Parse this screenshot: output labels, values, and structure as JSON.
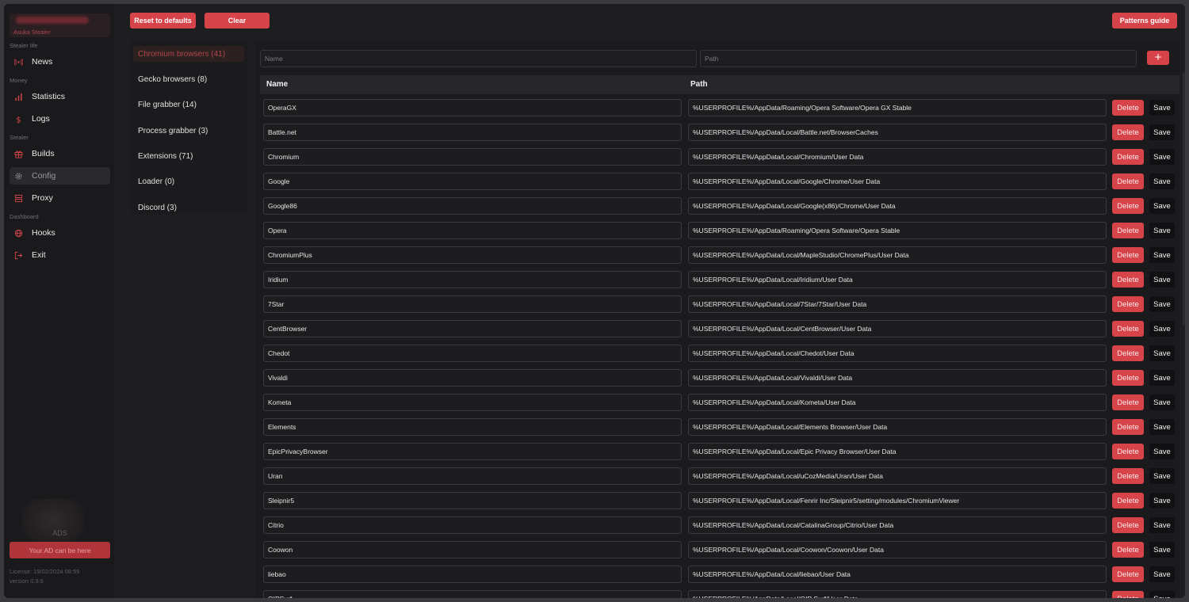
{
  "sidebar": {
    "brand_sub": "Asuka Stealer",
    "sections": {
      "stealer_life": "Stealer life",
      "money": "Money",
      "stealer": "Stealer",
      "dashboard": "Dashboard"
    },
    "items": [
      {
        "label": "News",
        "icon": "broadcast-icon"
      },
      {
        "label": "Statistics",
        "icon": "bar-chart-icon"
      },
      {
        "label": "Logs",
        "icon": "dollar-icon"
      },
      {
        "label": "Builds",
        "icon": "gift-icon"
      },
      {
        "label": "Config",
        "icon": "gear-icon",
        "active": true
      },
      {
        "label": "Proxy",
        "icon": "server-icon"
      },
      {
        "label": "Hooks",
        "icon": "globe-icon"
      },
      {
        "label": "Exit",
        "icon": "logout-icon"
      }
    ],
    "ads_label": "ADS",
    "ad_button": "Your AD can be here",
    "license": "License: 19/02/2024 08:59",
    "version": "version 0.9.6"
  },
  "toolbar": {
    "reset_label": "Reset to defaults",
    "clear_label": "Clear",
    "guide_label": "Patterns guide"
  },
  "categories": [
    {
      "label": "Chromium browsers (41)",
      "active": true
    },
    {
      "label": "Gecko browsers (8)"
    },
    {
      "label": "File grabber (14)"
    },
    {
      "label": "Process grabber (3)"
    },
    {
      "label": "Extensions (71)"
    },
    {
      "label": "Loader (0)"
    },
    {
      "label": "Discord (3)"
    }
  ],
  "form": {
    "name_placeholder": "Name",
    "path_placeholder": "Path",
    "add_symbol": "+"
  },
  "table": {
    "headers": {
      "name": "Name",
      "path": "Path"
    },
    "delete_label": "Delete",
    "save_label": "Save",
    "rows": [
      {
        "name": "OperaGX",
        "path": "%USERPROFILE%/AppData/Roaming/Opera Software/Opera GX Stable"
      },
      {
        "name": "Battle.net",
        "path": "%USERPROFILE%/AppData/Local/Battle.net/BrowserCaches"
      },
      {
        "name": "Chromium",
        "path": "%USERPROFILE%/AppData/Local/Chromium/User Data"
      },
      {
        "name": "Google",
        "path": "%USERPROFILE%/AppData/Local/Google/Chrome/User Data"
      },
      {
        "name": "Google86",
        "path": "%USERPROFILE%/AppData/Local/Google(x86)/Chrome/User Data"
      },
      {
        "name": "Opera",
        "path": "%USERPROFILE%/AppData/Roaming/Opera Software/Opera Stable"
      },
      {
        "name": "ChromiumPlus",
        "path": "%USERPROFILE%/AppData/Local/MapleStudio/ChromePlus/User Data"
      },
      {
        "name": "Iridium",
        "path": "%USERPROFILE%/AppData/Local/Iridium/User Data"
      },
      {
        "name": "7Star",
        "path": "%USERPROFILE%/AppData/Local/7Star/7Star/User Data"
      },
      {
        "name": "CentBrowser",
        "path": "%USERPROFILE%/AppData/Local/CentBrowser/User Data"
      },
      {
        "name": "Chedot",
        "path": "%USERPROFILE%/AppData/Local/Chedot/User Data"
      },
      {
        "name": "Vivaldi",
        "path": "%USERPROFILE%/AppData/Local/Vivaldi/User Data"
      },
      {
        "name": "Kometa",
        "path": "%USERPROFILE%/AppData/Local/Kometa/User Data"
      },
      {
        "name": "Elements",
        "path": "%USERPROFILE%/AppData/Local/Elements Browser/User Data"
      },
      {
        "name": "EpicPrivacyBrowser",
        "path": "%USERPROFILE%/AppData/Local/Epic Privacy Browser/User Data"
      },
      {
        "name": "Uran",
        "path": "%USERPROFILE%/AppData/Local/uCozMedia/Uran/User Data"
      },
      {
        "name": "Sleipnir5",
        "path": "%USERPROFILE%/AppData/Local/Fenrir Inc/Sleipnir5/setting/modules/ChromiumViewer"
      },
      {
        "name": "Citrio",
        "path": "%USERPROFILE%/AppData/Local/CatalinaGroup/Citrio/User Data"
      },
      {
        "name": "Coowon",
        "path": "%USERPROFILE%/AppData/Local/Coowon/Coowon/User Data"
      },
      {
        "name": "liebao",
        "path": "%USERPROFILE%/AppData/Local/liebao/User Data"
      },
      {
        "name": "QIPSurf",
        "path": "%USERPROFILE%/AppData/Local/QIP Surf/User Data"
      }
    ]
  },
  "colors": {
    "accent": "#d6444a",
    "background": "#1e1e21",
    "panel": "#1b1b1e"
  }
}
